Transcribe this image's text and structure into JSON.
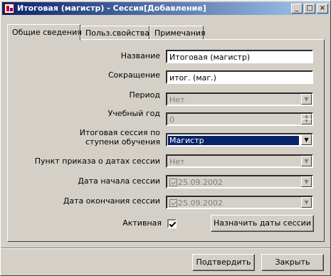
{
  "window": {
    "title": "Итоговая (магистр) - Сессия[Добавление]",
    "controls": {
      "minimize": "_",
      "maximize": "□",
      "close": "×"
    }
  },
  "tabs": [
    {
      "label": "Общие сведения",
      "active": true
    },
    {
      "label": "Польз.свойства",
      "active": false
    },
    {
      "label": "Примечания",
      "active": false
    }
  ],
  "form": {
    "name": {
      "label": "Название",
      "value": "Итоговая (магистр)"
    },
    "abbr": {
      "label": "Сокращение",
      "value": "итог. (маг.)"
    },
    "period": {
      "label": "Период",
      "value": "Нет"
    },
    "year": {
      "label": "Учебный год",
      "value": "0"
    },
    "final_session": {
      "label_line1": "Итоговая сессия по",
      "label_line2": "ступени обучения",
      "value": "Магистр"
    },
    "order_item": {
      "label": "Пункт приказа о датах сессии",
      "value": "Нет"
    },
    "start_date": {
      "label": "Дата начала сессии",
      "value": "25.09.2002"
    },
    "end_date": {
      "label": "Дата окончания сессии",
      "value": "25.09.2002"
    },
    "active": {
      "label": "Активная",
      "checked": true
    },
    "assign_dates_label": "Назначить даты сессии"
  },
  "footer": {
    "confirm_label": "Подтвердить",
    "close_label": "Закрыть"
  },
  "colors": {
    "titlebar_start": "#0a246a",
    "titlebar_end": "#a6caf0",
    "face": "#d4d0c8",
    "selection": "#0a246a"
  }
}
